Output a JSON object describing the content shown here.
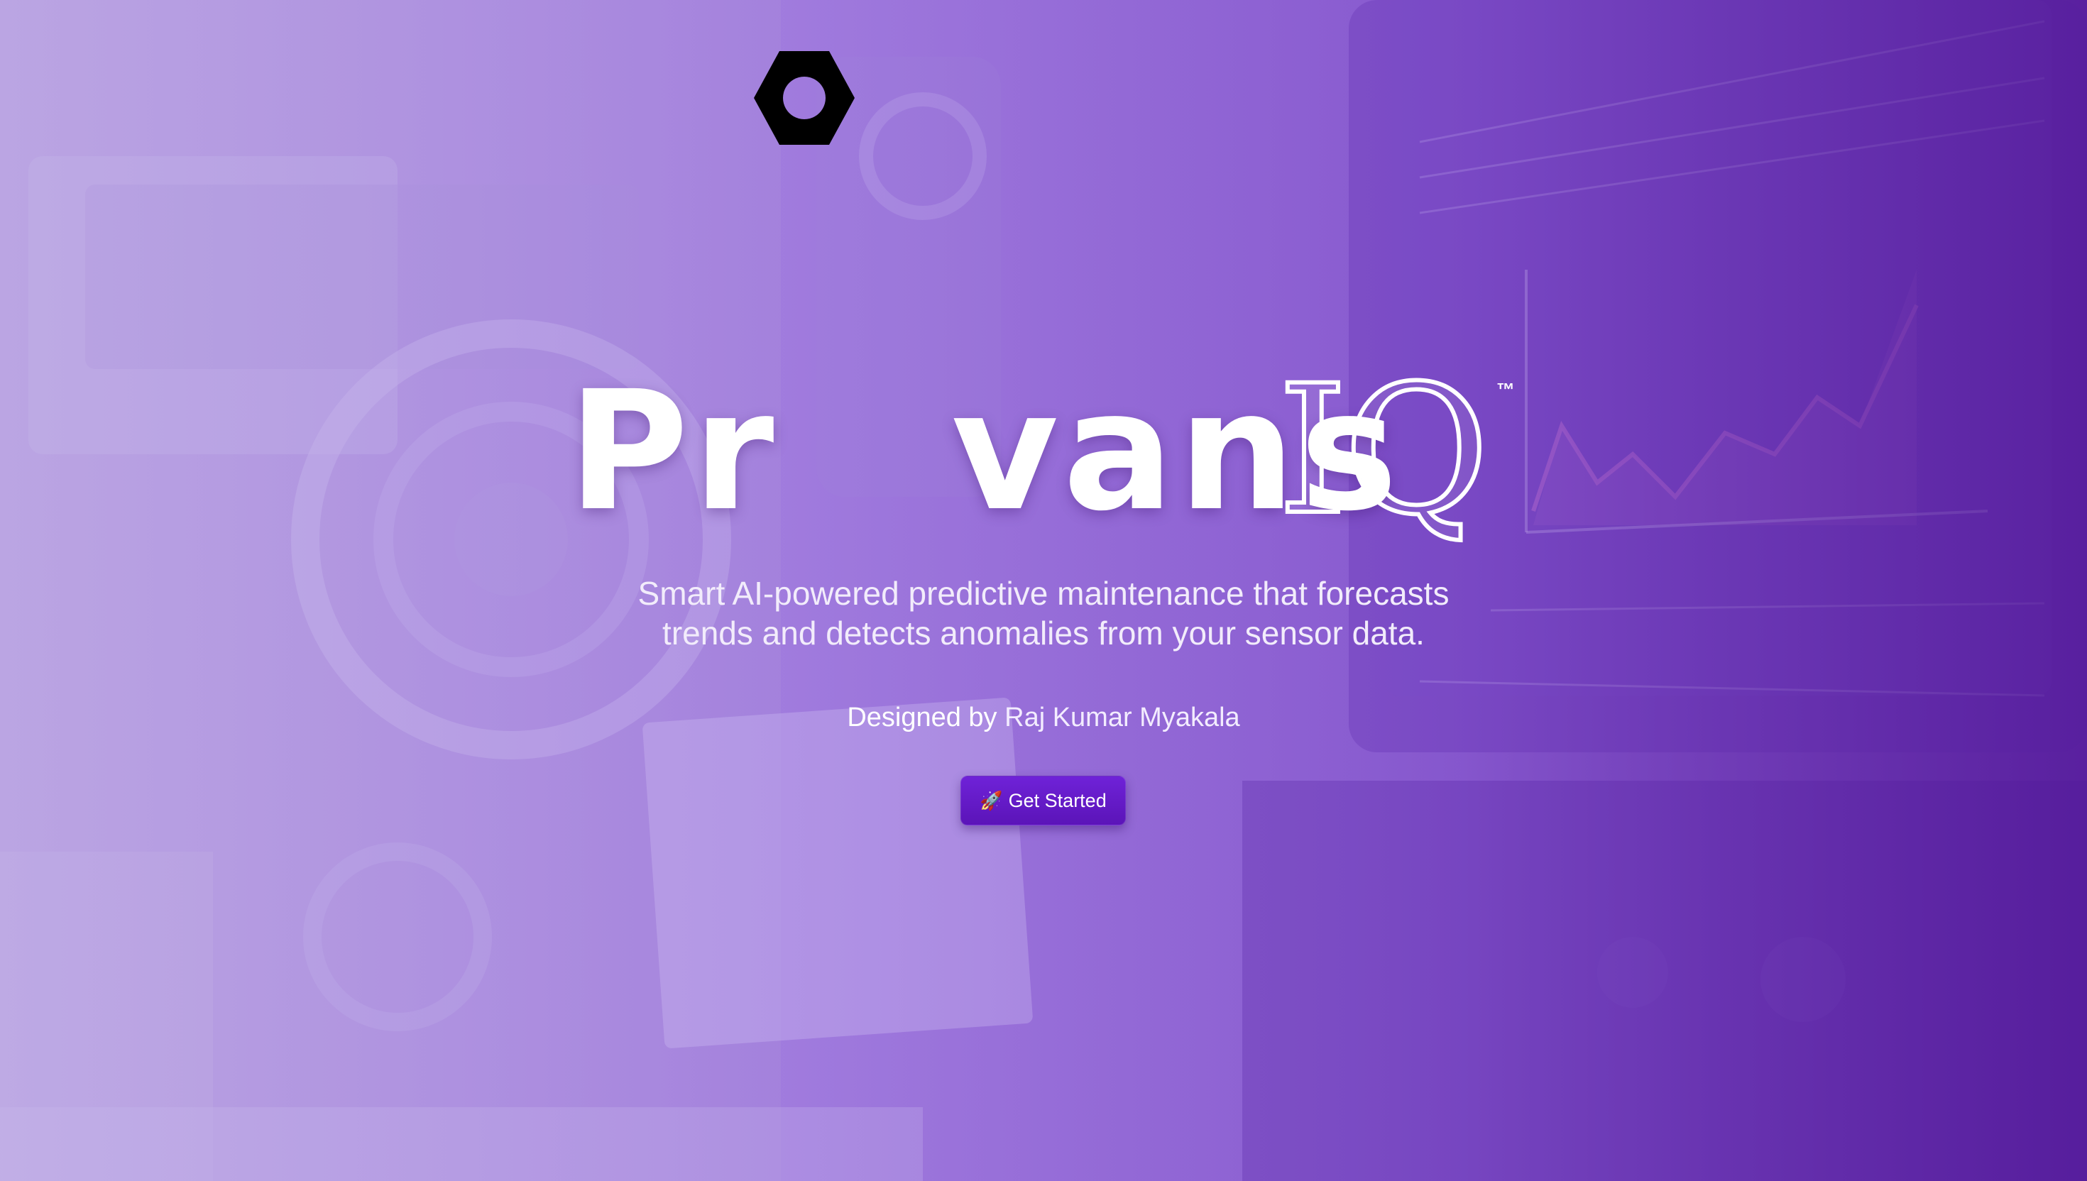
{
  "brand": {
    "name_part1": "Pr",
    "name_part2": "vans",
    "name_suffix": "IQ",
    "trademark": "™",
    "nut_color": "#000000"
  },
  "hero": {
    "tagline_line1": "Smart AI-powered predictive maintenance that forecasts",
    "tagline_line2": "trends and detects anomalies from your sensor data.",
    "credit_prefix": "Designed by ",
    "credit_author": "Raj Kumar Myakala"
  },
  "cta": {
    "icon": "rocket-icon",
    "label": "Get Started"
  },
  "colors": {
    "accent": "#6a1fd1",
    "background_start": "#c9b6ea",
    "background_end": "#4f1497"
  }
}
